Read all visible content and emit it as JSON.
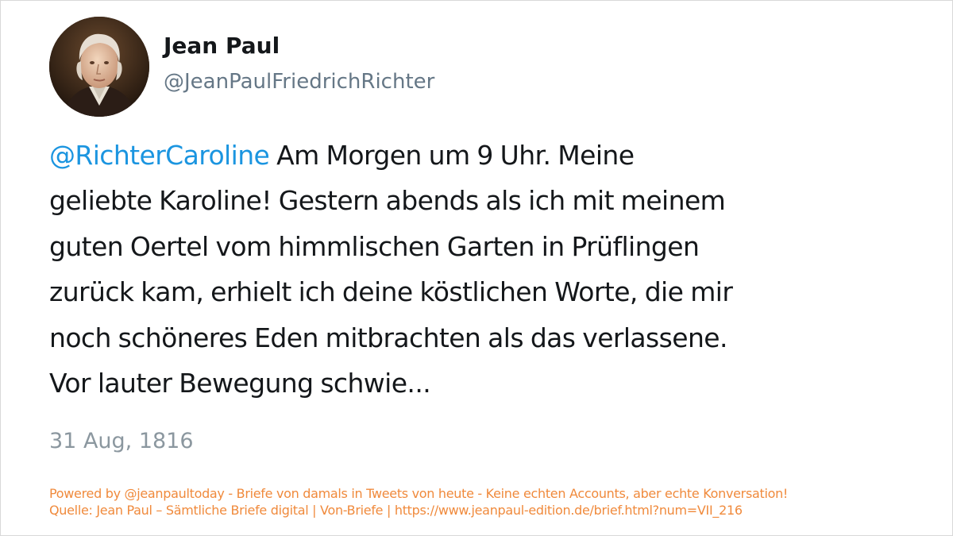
{
  "user": {
    "display_name": "Jean Paul",
    "handle": "@JeanPaulFriedrichRichter",
    "avatar": "portrait-avatar"
  },
  "tweet": {
    "mention": "@RichterCaroline",
    "line1_rest": " Am Morgen um 9 Uhr. Meine",
    "lines": [
      "geliebte Karoline! Gestern abends als ich mit meinem",
      "guten Oertel vom himmlischen Garten in Prüflingen",
      "zurück kam, erhielt ich deine köstlichen Worte, die mir",
      "noch schöneres Eden mitbrachten als das verlassene.",
      "Vor lauter Bewegung schwie..."
    ],
    "date": "31 Aug, 1816"
  },
  "footer": {
    "powered_by": "Powered by @jeanpaultoday - Briefe von damals in Tweets von heute - Keine echten Accounts, aber echte Konversation!",
    "source": "Quelle: Jean Paul – Sämtliche Briefe digital | Von-Briefe | https://www.jeanpaul-edition.de/brief.html?num=VII_216"
  },
  "colors": {
    "mention": "#1b95e0",
    "footer": "#f08a3c",
    "text": "#14171a",
    "muted": "#657786"
  }
}
